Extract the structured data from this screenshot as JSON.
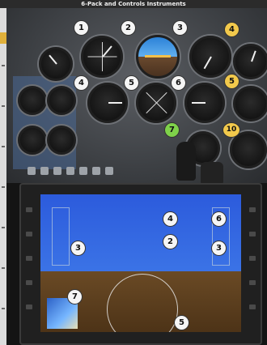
{
  "header": {
    "title": "6-Pack and Controls Instruments"
  },
  "badges": [
    {
      "label": "1",
      "color": "#f5f5f5"
    },
    {
      "label": "2",
      "color": "#f5f5f5"
    },
    {
      "label": "3",
      "color": "#f5f5f5"
    },
    {
      "label": "4",
      "color": "#f2c94c"
    },
    {
      "label": "4",
      "color": "#f5f5f5"
    },
    {
      "label": "5",
      "color": "#f5f5f5"
    },
    {
      "label": "6",
      "color": "#f5f5f5"
    },
    {
      "label": "5",
      "color": "#f2c94c"
    },
    {
      "label": "7",
      "color": "#7fd24a"
    },
    {
      "label": "10",
      "color": "#f2c94c"
    },
    {
      "label": "4",
      "color": "#f5f5f5"
    },
    {
      "label": "6",
      "color": "#f5f5f5"
    },
    {
      "label": "3",
      "color": "#f5f5f5"
    },
    {
      "label": "2",
      "color": "#f5f5f5"
    },
    {
      "label": "3",
      "color": "#f5f5f5"
    },
    {
      "label": "7",
      "color": "#f5f5f5"
    },
    {
      "label": "5",
      "color": "#f5f5f5"
    }
  ],
  "colors": {
    "badge_white": "#f5f5f5",
    "badge_yellow": "#f2c94c",
    "badge_green": "#7fd24a",
    "sky_blue": "#2c5bdc",
    "ground_brown": "#6a4a25",
    "panel_gray": "#3d4044"
  },
  "icons": {
    "attitude": "attitude-indicator-icon",
    "gauge": "round-gauge-icon",
    "yoke": "control-yoke-icon"
  }
}
